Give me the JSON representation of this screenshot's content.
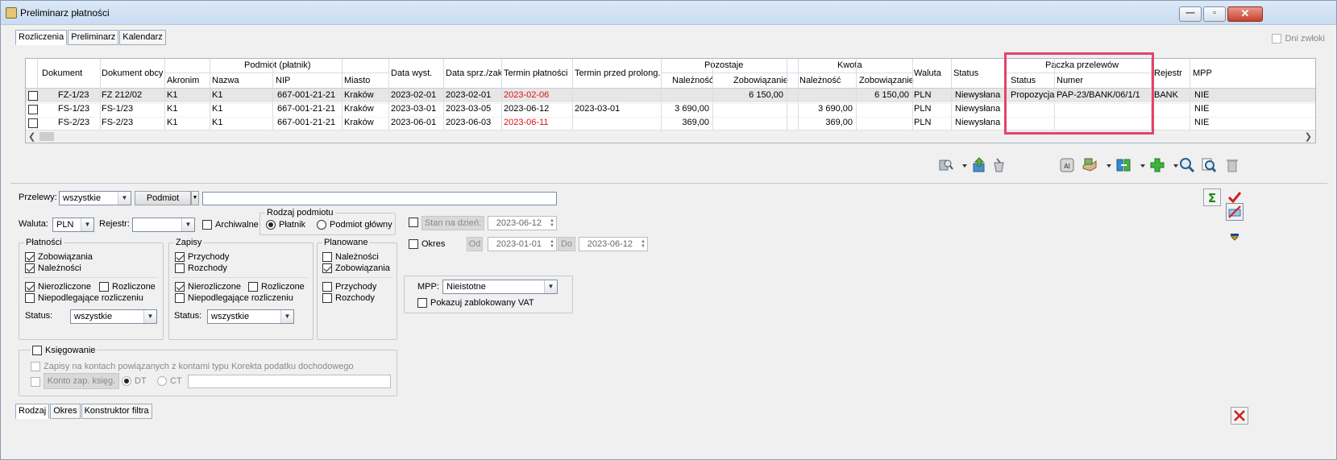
{
  "window": {
    "title": "Preliminarz płatności"
  },
  "top_tabs": [
    "Rozliczenia",
    "Preliminarz",
    "Kalendarz"
  ],
  "dni_zwloki_label": "Dni zwłoki",
  "grid": {
    "headers": {
      "dokument": "Dokument",
      "dokument_obcy": "Dokument obcy",
      "podmiot_group": "Podmiot (płatnik)",
      "akronim": "Akronim",
      "nazwa": "Nazwa",
      "nip": "NIP",
      "miasto": "Miasto",
      "data_wyst": "Data wyst.",
      "data_sprz": "Data sprz./zak",
      "termin": "Termin płatności",
      "termin_prolong": "Termin przed prolong.",
      "pozostaje": "Pozostaje",
      "pozostaje_nal": "Należność",
      "pozostaje_zob": "Zobowiązanie",
      "kwota": "Kwota",
      "kwota_nal": "Należność",
      "kwota_zob": "Zobowiązanie",
      "waluta": "Waluta",
      "status": "Status",
      "paczka": "Paczka przelewów",
      "paczka_status": "Status",
      "paczka_numer": "Numer",
      "rejestr": "Rejestr",
      "mpp": "MPP"
    },
    "rows": [
      {
        "dokument": "FZ-1/23",
        "obcy": "FZ 212/02",
        "akronim": "K1",
        "nazwa": "K1",
        "nip": "667-001-21-21",
        "miasto": "Kraków",
        "data_wyst": "2023-02-01",
        "data_sprz": "2023-02-01",
        "termin": "2023-02-06",
        "termin_red": true,
        "prolong": "",
        "poz_nal": "",
        "poz_zob": "6 150,00",
        "kw_nal": "",
        "kw_zob": "6 150,00",
        "waluta": "PLN",
        "status": "Niewysłana",
        "p_status": "Propozycja",
        "p_numer": "PAP-23/BANK/06/1/1",
        "rejestr": "BANK",
        "mpp": "NIE"
      },
      {
        "dokument": "FS-1/23",
        "obcy": "FS-1/23",
        "akronim": "K1",
        "nazwa": "K1",
        "nip": "667-001-21-21",
        "miasto": "Kraków",
        "data_wyst": "2023-03-01",
        "data_sprz": "2023-03-05",
        "termin": "2023-06-12",
        "termin_red": false,
        "prolong": "2023-03-01",
        "poz_nal": "3 690,00",
        "poz_zob": "",
        "kw_nal": "3 690,00",
        "kw_zob": "",
        "waluta": "PLN",
        "status": "Niewysłana",
        "p_status": "",
        "p_numer": "",
        "rejestr": "",
        "mpp": "NIE"
      },
      {
        "dokument": "FS-2/23",
        "obcy": "FS-2/23",
        "akronim": "K1",
        "nazwa": "K1",
        "nip": "667-001-21-21",
        "miasto": "Kraków",
        "data_wyst": "2023-06-01",
        "data_sprz": "2023-06-03",
        "termin": "2023-06-11",
        "termin_red": true,
        "prolong": "",
        "poz_nal": "369,00",
        "poz_zob": "",
        "kw_nal": "369,00",
        "kw_zob": "",
        "waluta": "PLN",
        "status": "Niewysłana",
        "p_status": "",
        "p_numer": "",
        "rejestr": "",
        "mpp": "NIE"
      }
    ]
  },
  "filters": {
    "przelewy_label": "Przelewy:",
    "przelewy_value": "wszystkie",
    "podmiot_button": "Podmiot",
    "podmiot_value": "",
    "waluta_label": "Waluta:",
    "waluta_value": "PLN",
    "rejestr_label": "Rejestr:",
    "rejestr_value": "",
    "archiwalne_label": "Archiwalne",
    "rodzaj_podmiotu": "Rodzaj podmiotu",
    "platnik": "Płatnik",
    "podmiot_glowny": "Podmiot główny",
    "stan_na_dzien_btn": "Stan na dzień:",
    "stan_na_dzien_value": "2023-06-12",
    "okres_label": "Okres",
    "od_btn": "Od",
    "od_value": "2023-01-01",
    "do_btn": "Do",
    "do_value": "2023-06-12",
    "platnosci": {
      "title": "Płatności",
      "zobowiazania": "Zobowiązania",
      "naleznosci": "Należności",
      "nierozliczone": "Nierozliczone",
      "rozliczone": "Rozliczone",
      "niepodlegajace": "Niepodlegające rozliczeniu",
      "status_label": "Status:",
      "status_value": "wszystkie"
    },
    "zapisy": {
      "title": "Zapisy",
      "przychody": "Przychody",
      "rozchody": "Rozchody",
      "nierozliczone": "Nierozliczone",
      "rozliczone": "Rozliczone",
      "niepodlegajace": "Niepodlegające rozliczeniu",
      "status_label": "Status:",
      "status_value": "wszystkie"
    },
    "planowane": {
      "title": "Planowane",
      "naleznosci": "Należności",
      "zobowiazania": "Zobowiązania",
      "przychody": "Przychody",
      "rozchody": "Rozchody"
    },
    "mpp_label": "MPP:",
    "mpp_value": "Nieistotne",
    "pokazuj_vat": "Pokazuj zablokowany VAT",
    "ksiegowanie": "Księgowanie",
    "zapisy_kontach": "Zapisy na kontach powiązanych z kontami typu Korekta podatku dochodowego",
    "konto_btn": "Konto zap. księg.",
    "dt": "DT",
    "ct": "CT"
  },
  "bottom_tabs": [
    "Rodzaj",
    "Okres",
    "Konstruktor filtra"
  ]
}
